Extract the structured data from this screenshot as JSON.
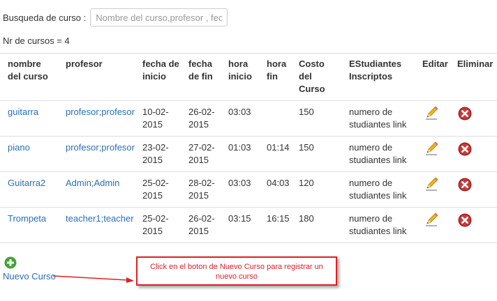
{
  "search": {
    "label": "Busqueda de curso :",
    "placeholder": "Nombre del curso,profesor , fech"
  },
  "count_text": "Nr de cursos = 4",
  "table": {
    "headers": [
      [
        "nombre",
        "del curso"
      ],
      [
        "profesor"
      ],
      [
        "fecha de",
        "inicio"
      ],
      [
        "fecha",
        "de fin"
      ],
      [
        "hora",
        "inicio"
      ],
      [
        "hora",
        "fin"
      ],
      [
        "Costo",
        "del",
        "Curso"
      ],
      [
        "EStudiantes",
        "Inscriptos"
      ],
      [
        "Editar"
      ],
      [
        "Eliminar"
      ]
    ],
    "rows": [
      {
        "nombre": "guitarra",
        "profesor": "profesor;profesor",
        "fecha_inicio": [
          "10-02-",
          "2015"
        ],
        "fecha_fin": [
          "26-02-",
          "2015"
        ],
        "hora_inicio": "03:03",
        "hora_fin": "",
        "costo": "150",
        "estudiantes": [
          "numero de",
          "studiantes link"
        ]
      },
      {
        "nombre": "piano",
        "profesor": "profesor;profesor",
        "fecha_inicio": [
          "23-02-",
          "2015"
        ],
        "fecha_fin": [
          "27-02-",
          "2015"
        ],
        "hora_inicio": "01:03",
        "hora_fin": "01:14",
        "costo": "150",
        "estudiantes": [
          "numero de",
          "studiantes link"
        ]
      },
      {
        "nombre": "Guitarra2",
        "profesor": "Admin;Admin",
        "fecha_inicio": [
          "25-02-",
          "2015"
        ],
        "fecha_fin": [
          "28-02-",
          "2015"
        ],
        "hora_inicio": "03:03",
        "hora_fin": "04:03",
        "costo": "120",
        "estudiantes": [
          "numero de",
          "studiantes link"
        ]
      },
      {
        "nombre": "Trompeta",
        "profesor": "teacher1;teacher",
        "fecha_inicio": [
          "25-02-",
          "2015"
        ],
        "fecha_fin": [
          "26-02-",
          "2015"
        ],
        "hora_inicio": "03:15",
        "hora_fin": "16:15",
        "costo": "180",
        "estudiantes": [
          "numero de",
          "studiantes link"
        ]
      }
    ]
  },
  "new_course_label": "Nuevo Curso",
  "callout": [
    "Click en el boton de Nuevo Curso para registrar un",
    "nuevo curso"
  ],
  "icons": {
    "edit": "pencil-icon",
    "delete": "delete-icon",
    "add": "plus-circle-icon"
  },
  "colors": {
    "link": "#2a6fb5",
    "delete": "#9b2020",
    "add": "#3fa535",
    "callout": "#e02020"
  }
}
